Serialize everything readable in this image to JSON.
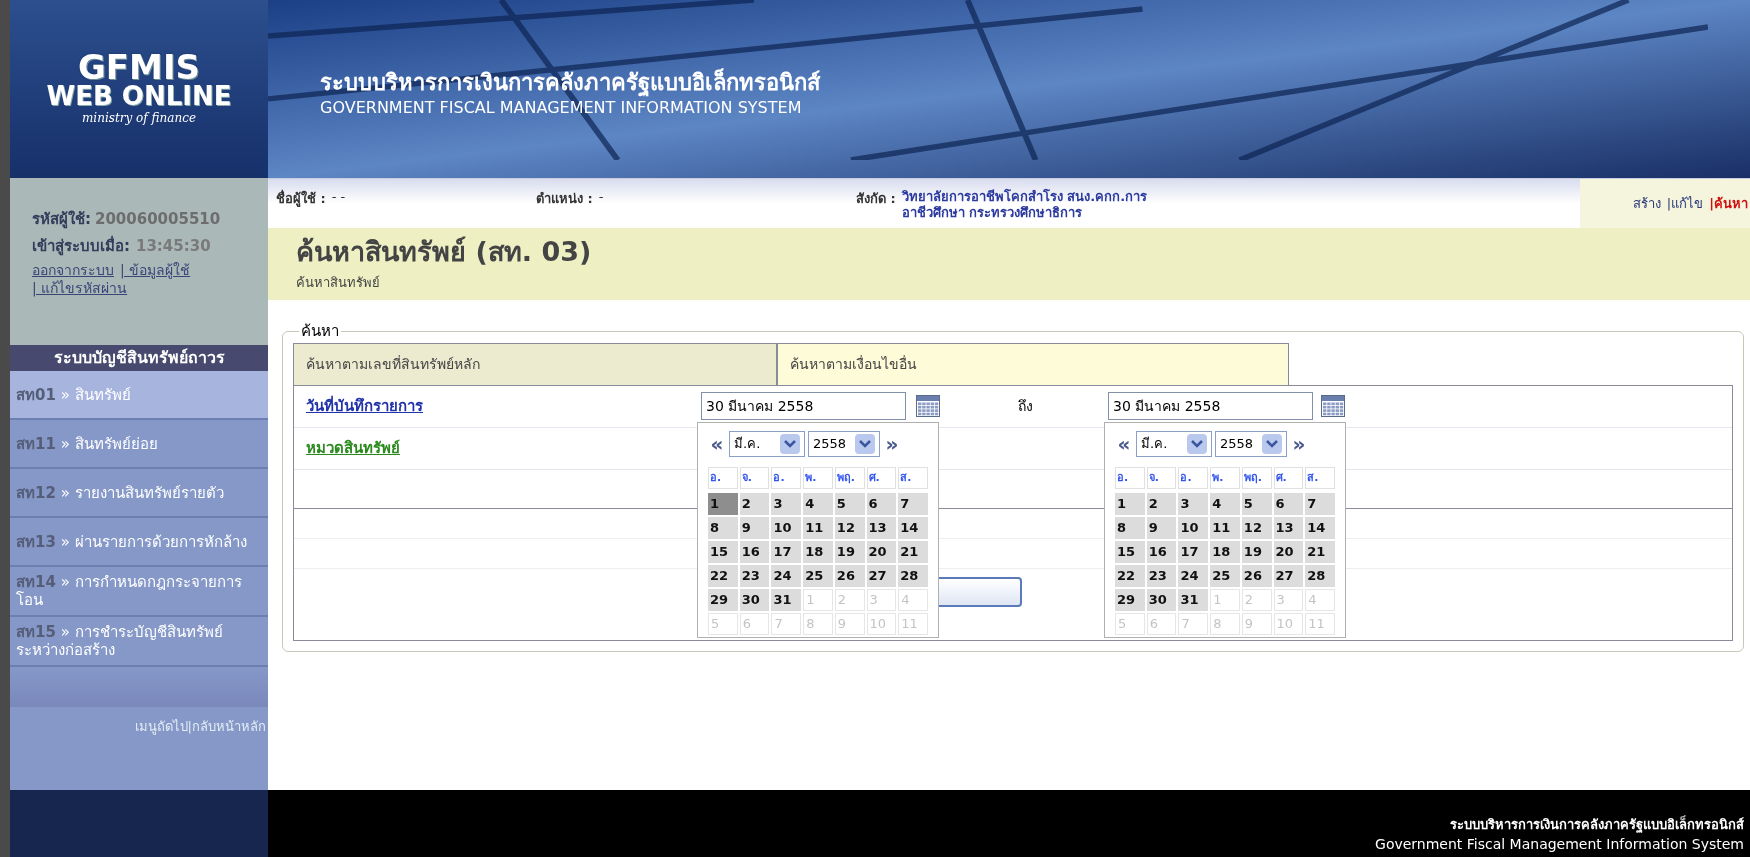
{
  "header": {
    "logo": {
      "line1": "GFMIS",
      "line2": "WEB ONLINE",
      "line3": "ministry of finance"
    },
    "title_th": "ระบบบริหารการเงินการคลังภาครัฐแบบอิเล็กทรอนิกส์",
    "title_en": "GOVERNMENT FISCAL MANAGEMENT INFORMATION SYSTEM"
  },
  "user_panel": {
    "user_id_label": "รหัสผู้ใช้:",
    "user_id": "200060005510",
    "login_label": "เข้าสู่ระบบเมื่อ:",
    "login_time": "13:45:30",
    "links": [
      "ออกจากระบบ",
      "| ข้อมูลผู้ใช้",
      "| แก้ไขรหัสผ่าน"
    ]
  },
  "sidebar": {
    "title": "ระบบบัญชีสินทรัพย์ถาวร",
    "items": [
      {
        "code": "สท01",
        "label": "» สินทรัพย์",
        "selected": true
      },
      {
        "code": "สท11",
        "label": "» สินทรัพย์ย่อย",
        "selected": false
      },
      {
        "code": "สท12",
        "label": "» รายงานสินทรัพย์รายตัว",
        "selected": false
      },
      {
        "code": "สท13",
        "label": "» ผ่านรายการด้วยการหักล้าง",
        "selected": false
      },
      {
        "code": "สท14",
        "label": "» การกำหนดกฎกระจายการโอน",
        "selected": false
      },
      {
        "code": "สท15",
        "label": "» การชำระบัญชีสินทรัพย์ระหว่างก่อสร้าง",
        "selected": false
      }
    ],
    "bottom_links": [
      "เมนูถัดไป",
      "|กลับหน้าหลัก"
    ]
  },
  "info_bar": {
    "fields": [
      {
        "label": "ชื่อผู้ใช้ :",
        "lines": [
          "- -"
        ]
      },
      {
        "label": "ตำแหน่ง :",
        "lines": [
          "-"
        ]
      },
      {
        "label": "สังกัด :",
        "lines": [
          "วิทยาลัยการอาชีพโคกสำโรง สนง.คกก.การ",
          "อาชีวศึกษา กระทรวงศึกษาธิการ"
        ]
      }
    ],
    "actions": [
      {
        "label": "สร้าง",
        "selected": false
      },
      {
        "label": "|แก้ไข",
        "selected": false
      },
      {
        "label": "|ค้นหา",
        "selected": true
      }
    ]
  },
  "page": {
    "title": "ค้นหาสินทรัพย์ (สท. 03)",
    "subtitle": "ค้นหาสินทรัพย์"
  },
  "search": {
    "legend": "ค้นหา",
    "tabs": [
      {
        "label": "ค้นหาตามเลขที่สินทรัพย์หลัก",
        "selected": true
      },
      {
        "label": "ค้นหาตามเงื่อนไขอื่น",
        "selected": false
      }
    ],
    "fields": [
      {
        "kind": "date_range",
        "label": "วันที่บันทึกรายการ",
        "from": "30 มีนาคม 2558",
        "to_label": "ถึง",
        "to": "30 มีนาคม 2558"
      },
      {
        "kind": "category",
        "label": "หมวดสินทรัพย์"
      }
    ]
  },
  "calendars": [
    {
      "prev": "«",
      "next": "»",
      "month": "มี.ค.",
      "year": "2558",
      "weekdays": [
        "อ.",
        "จ.",
        "อ.",
        "พ.",
        "พฤ.",
        "ศ.",
        "ส."
      ],
      "weeks": [
        [
          {
            "d": "1",
            "kind": "current",
            "selected": true
          },
          {
            "d": "2",
            "kind": "current",
            "selected": false
          },
          {
            "d": "3",
            "kind": "current",
            "selected": false
          },
          {
            "d": "4",
            "kind": "current",
            "selected": false
          },
          {
            "d": "5",
            "kind": "current",
            "selected": false
          },
          {
            "d": "6",
            "kind": "current",
            "selected": false
          },
          {
            "d": "7",
            "kind": "current",
            "selected": false
          }
        ],
        [
          {
            "d": "8",
            "kind": "current",
            "selected": false
          },
          {
            "d": "9",
            "kind": "current",
            "selected": false
          },
          {
            "d": "10",
            "kind": "current",
            "selected": false
          },
          {
            "d": "11",
            "kind": "current",
            "selected": false
          },
          {
            "d": "12",
            "kind": "current",
            "selected": false
          },
          {
            "d": "13",
            "kind": "current",
            "selected": false
          },
          {
            "d": "14",
            "kind": "current",
            "selected": false
          }
        ],
        [
          {
            "d": "15",
            "kind": "current",
            "selected": false
          },
          {
            "d": "16",
            "kind": "current",
            "selected": false
          },
          {
            "d": "17",
            "kind": "current",
            "selected": false
          },
          {
            "d": "18",
            "kind": "current",
            "selected": false
          },
          {
            "d": "19",
            "kind": "current",
            "selected": false
          },
          {
            "d": "20",
            "kind": "current",
            "selected": false
          },
          {
            "d": "21",
            "kind": "current",
            "selected": false
          }
        ],
        [
          {
            "d": "22",
            "kind": "current",
            "selected": false
          },
          {
            "d": "23",
            "kind": "current",
            "selected": false
          },
          {
            "d": "24",
            "kind": "current",
            "selected": false
          },
          {
            "d": "25",
            "kind": "current",
            "selected": false
          },
          {
            "d": "26",
            "kind": "current",
            "selected": false
          },
          {
            "d": "27",
            "kind": "current",
            "selected": false
          },
          {
            "d": "28",
            "kind": "current",
            "selected": false
          }
        ],
        [
          {
            "d": "29",
            "kind": "current",
            "selected": false
          },
          {
            "d": "30",
            "kind": "current",
            "selected": false
          },
          {
            "d": "31",
            "kind": "current",
            "selected": false
          },
          {
            "d": "1",
            "kind": "adjacent",
            "selected": false
          },
          {
            "d": "2",
            "kind": "adjacent",
            "selected": false
          },
          {
            "d": "3",
            "kind": "adjacent",
            "selected": false
          },
          {
            "d": "4",
            "kind": "adjacent",
            "selected": false
          }
        ],
        [
          {
            "d": "5",
            "kind": "adjacent",
            "selected": false
          },
          {
            "d": "6",
            "kind": "adjacent",
            "selected": false
          },
          {
            "d": "7",
            "kind": "adjacent",
            "selected": false
          },
          {
            "d": "8",
            "kind": "adjacent",
            "selected": false
          },
          {
            "d": "9",
            "kind": "adjacent",
            "selected": false
          },
          {
            "d": "10",
            "kind": "adjacent",
            "selected": false
          },
          {
            "d": "11",
            "kind": "adjacent",
            "selected": false
          }
        ]
      ]
    },
    {
      "prev": "«",
      "next": "»",
      "month": "มี.ค.",
      "year": "2558",
      "weekdays": [
        "อ.",
        "จ.",
        "อ.",
        "พ.",
        "พฤ.",
        "ศ.",
        "ส."
      ],
      "weeks": [
        [
          {
            "d": "1",
            "kind": "current",
            "selected": false
          },
          {
            "d": "2",
            "kind": "current",
            "selected": false
          },
          {
            "d": "3",
            "kind": "current",
            "selected": false
          },
          {
            "d": "4",
            "kind": "current",
            "selected": false
          },
          {
            "d": "5",
            "kind": "current",
            "selected": false
          },
          {
            "d": "6",
            "kind": "current",
            "selected": false
          },
          {
            "d": "7",
            "kind": "current",
            "selected": false
          }
        ],
        [
          {
            "d": "8",
            "kind": "current",
            "selected": false
          },
          {
            "d": "9",
            "kind": "current",
            "selected": false
          },
          {
            "d": "10",
            "kind": "current",
            "selected": false
          },
          {
            "d": "11",
            "kind": "current",
            "selected": false
          },
          {
            "d": "12",
            "kind": "current",
            "selected": false
          },
          {
            "d": "13",
            "kind": "current",
            "selected": false
          },
          {
            "d": "14",
            "kind": "current",
            "selected": false
          }
        ],
        [
          {
            "d": "15",
            "kind": "current",
            "selected": false
          },
          {
            "d": "16",
            "kind": "current",
            "selected": false
          },
          {
            "d": "17",
            "kind": "current",
            "selected": false
          },
          {
            "d": "18",
            "kind": "current",
            "selected": false
          },
          {
            "d": "19",
            "kind": "current",
            "selected": false
          },
          {
            "d": "20",
            "kind": "current",
            "selected": false
          },
          {
            "d": "21",
            "kind": "current",
            "selected": false
          }
        ],
        [
          {
            "d": "22",
            "kind": "current",
            "selected": false
          },
          {
            "d": "23",
            "kind": "current",
            "selected": false
          },
          {
            "d": "24",
            "kind": "current",
            "selected": false
          },
          {
            "d": "25",
            "kind": "current",
            "selected": false
          },
          {
            "d": "26",
            "kind": "current",
            "selected": false
          },
          {
            "d": "27",
            "kind": "current",
            "selected": false
          },
          {
            "d": "28",
            "kind": "current",
            "selected": false
          }
        ],
        [
          {
            "d": "29",
            "kind": "current",
            "selected": false
          },
          {
            "d": "30",
            "kind": "current",
            "selected": false
          },
          {
            "d": "31",
            "kind": "current",
            "selected": false
          },
          {
            "d": "1",
            "kind": "adjacent",
            "selected": false
          },
          {
            "d": "2",
            "kind": "adjacent",
            "selected": false
          },
          {
            "d": "3",
            "kind": "adjacent",
            "selected": false
          },
          {
            "d": "4",
            "kind": "adjacent",
            "selected": false
          }
        ],
        [
          {
            "d": "5",
            "kind": "adjacent",
            "selected": false
          },
          {
            "d": "6",
            "kind": "adjacent",
            "selected": false
          },
          {
            "d": "7",
            "kind": "adjacent",
            "selected": false
          },
          {
            "d": "8",
            "kind": "adjacent",
            "selected": false
          },
          {
            "d": "9",
            "kind": "adjacent",
            "selected": false
          },
          {
            "d": "10",
            "kind": "adjacent",
            "selected": false
          },
          {
            "d": "11",
            "kind": "adjacent",
            "selected": false
          }
        ]
      ]
    }
  ],
  "footer": {
    "th": "ระบบบริหารการเงินการคลังภาครัฐแบบอิเล็กทรอนิกส์",
    "en": "Government Fiscal Management Information System"
  }
}
